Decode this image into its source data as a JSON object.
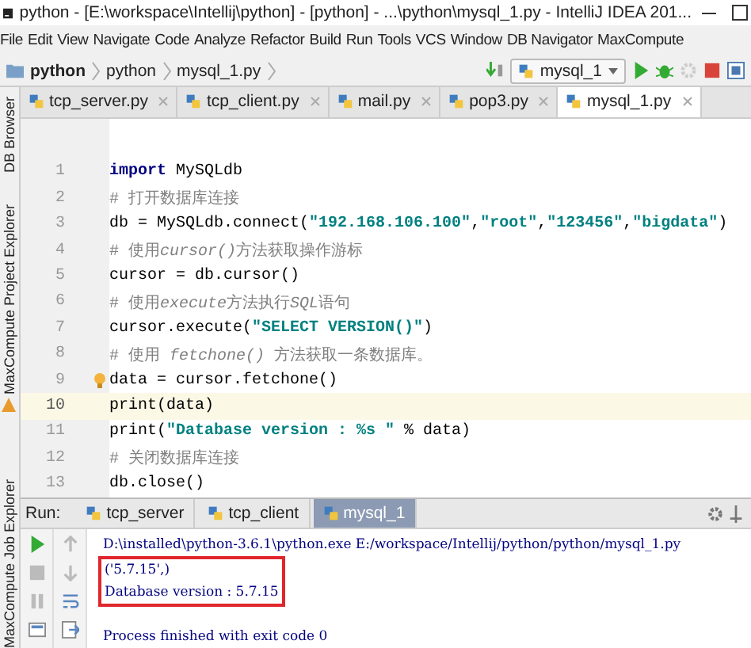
{
  "window": {
    "title": "python - [E:\\workspace\\Intellij\\python] - [python] - ...\\python\\mysql_1.py - IntelliJ IDEA 201..."
  },
  "menu": [
    "File",
    "Edit",
    "View",
    "Navigate",
    "Code",
    "Analyze",
    "Refactor",
    "Build",
    "Run",
    "Tools",
    "VCS",
    "Window",
    "DB Navigator",
    "MaxCompute"
  ],
  "breadcrumb": [
    "python",
    "python",
    "mysql_1.py"
  ],
  "run_config": "mysql_1",
  "tabs": [
    {
      "label": "tcp_server.py",
      "selected": false
    },
    {
      "label": "tcp_client.py",
      "selected": false
    },
    {
      "label": "mail.py",
      "selected": false
    },
    {
      "label": "pop3.py",
      "selected": false
    },
    {
      "label": "mysql_1.py",
      "selected": true
    }
  ],
  "side_panels": [
    "DB Browser",
    "MaxCompute Project Explorer",
    "MaxCompute Job Explorer"
  ],
  "editor": {
    "lines": [
      {
        "number": "1",
        "current": false,
        "tokens": [
          {
            "kind": "keyword",
            "text": "import"
          },
          {
            "kind": "plain",
            "text": " MySQLdb"
          }
        ]
      },
      {
        "number": "2",
        "current": false,
        "tokens": [
          {
            "kind": "comment",
            "text": "# 打开数据库连接"
          }
        ]
      },
      {
        "number": "3",
        "current": false,
        "tokens": [
          {
            "kind": "plain",
            "text": "db = MySQLdb.connect("
          },
          {
            "kind": "string",
            "text": "\"192.168.106.100\""
          },
          {
            "kind": "plain",
            "text": ","
          },
          {
            "kind": "string",
            "text": "\"root\""
          },
          {
            "kind": "plain",
            "text": ","
          },
          {
            "kind": "string",
            "text": "\"123456\""
          },
          {
            "kind": "plain",
            "text": ","
          },
          {
            "kind": "string",
            "text": "\"bigdata\""
          },
          {
            "kind": "plain",
            "text": ")"
          }
        ]
      },
      {
        "number": "4",
        "current": false,
        "tokens": [
          {
            "kind": "comment",
            "text": "# 使用"
          },
          {
            "kind": "comment_em",
            "text": "cursor()"
          },
          {
            "kind": "comment",
            "text": "方法获取操作游标"
          }
        ]
      },
      {
        "number": "5",
        "current": false,
        "tokens": [
          {
            "kind": "plain",
            "text": "cursor = db.cursor()"
          }
        ]
      },
      {
        "number": "6",
        "current": false,
        "tokens": [
          {
            "kind": "comment",
            "text": "# 使用"
          },
          {
            "kind": "comment_em",
            "text": "execute"
          },
          {
            "kind": "comment",
            "text": "方法执行"
          },
          {
            "kind": "comment_em",
            "text": "SQL"
          },
          {
            "kind": "comment",
            "text": "语句"
          }
        ]
      },
      {
        "number": "7",
        "current": false,
        "tokens": [
          {
            "kind": "plain",
            "text": "cursor.execute("
          },
          {
            "kind": "string",
            "text": "\"SELECT VERSION()\""
          },
          {
            "kind": "plain",
            "text": ")"
          }
        ]
      },
      {
        "number": "8",
        "current": false,
        "tokens": [
          {
            "kind": "comment",
            "text": "# 使用 "
          },
          {
            "kind": "comment_em",
            "text": "fetchone()"
          },
          {
            "kind": "comment",
            "text": " 方法获取一条数据库。"
          }
        ]
      },
      {
        "number": "9",
        "current": false,
        "tokens": [
          {
            "kind": "plain",
            "text": "data = cursor.fetchone()"
          }
        ]
      },
      {
        "number": "10",
        "current": true,
        "tokens": [
          {
            "kind": "plain",
            "text": "print(data)"
          }
        ]
      },
      {
        "number": "11",
        "current": false,
        "tokens": [
          {
            "kind": "plain",
            "text": "print("
          },
          {
            "kind": "string",
            "text": "\"Database version : %s \""
          },
          {
            "kind": "plain",
            "text": " % data)"
          }
        ]
      },
      {
        "number": "12",
        "current": false,
        "tokens": [
          {
            "kind": "comment",
            "text": "# 关闭数据库连接"
          }
        ]
      },
      {
        "number": "13",
        "current": false,
        "tokens": [
          {
            "kind": "plain",
            "text": "db.close()"
          }
        ]
      }
    ]
  },
  "run_panel": {
    "label": "Run:",
    "tabs": [
      {
        "label": "tcp_server",
        "selected": false
      },
      {
        "label": "tcp_client",
        "selected": false
      },
      {
        "label": "mysql_1",
        "selected": true
      }
    ],
    "output": [
      {
        "kind": "command",
        "text": "D:\\installed\\python-3.6.1\\python.exe E:/workspace/Intellij/python/python/mysql_1.py",
        "highlighted": false
      },
      {
        "kind": "result",
        "text": "('5.7.15',)",
        "highlighted": true
      },
      {
        "kind": "result",
        "text": "Database version : 5.7.15",
        "highlighted": true
      },
      {
        "kind": "status",
        "text": "Process finished with exit code 0",
        "highlighted": false
      }
    ]
  }
}
